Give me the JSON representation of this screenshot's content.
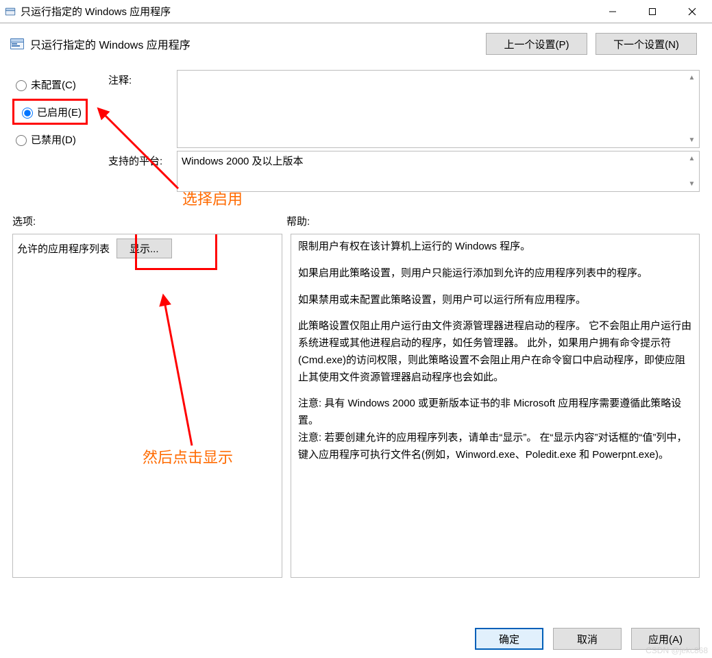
{
  "window": {
    "title": "只运行指定的 Windows 应用程序"
  },
  "header": {
    "policy_title": "只运行指定的 Windows 应用程序",
    "prev_btn": "上一个设置(P)",
    "next_btn": "下一个设置(N)"
  },
  "radios": {
    "not_configured": "未配置(C)",
    "enabled": "已启用(E)",
    "disabled": "已禁用(D)",
    "selected": "enabled"
  },
  "comment": {
    "label": "注释:",
    "value": ""
  },
  "platform": {
    "label": "支持的平台:",
    "value": "Windows 2000 及以上版本"
  },
  "sections": {
    "options_label": "选项:",
    "help_label": "帮助:"
  },
  "options": {
    "allowed_list_label": "允许的应用程序列表",
    "show_btn": "显示..."
  },
  "help": {
    "p1": "限制用户有权在该计算机上运行的 Windows 程序。",
    "p2": "如果启用此策略设置，则用户只能运行添加到允许的应用程序列表中的程序。",
    "p3": "如果禁用或未配置此策略设置，则用户可以运行所有应用程序。",
    "p4": "此策略设置仅阻止用户运行由文件资源管理器进程启动的程序。 它不会阻止用户运行由系统进程或其他进程启动的程序，如任务管理器。 此外，如果用户拥有命令提示符(Cmd.exe)的访问权限，则此策略设置不会阻止用户在命令窗口中启动程序，即使应阻止其使用文件资源管理器启动程序也会如此。",
    "p5": "注意: 具有 Windows 2000 或更新版本证书的非 Microsoft 应用程序需要遵循此策略设置。",
    "p6": "注意: 若要创建允许的应用程序列表，请单击“显示”。 在“显示内容”对话框的“值”列中，键入应用程序可执行文件名(例如，Winword.exe、Poledit.exe 和 Powerpnt.exe)。"
  },
  "annotations": {
    "enable_note": "选择启用",
    "show_note": "然后点击显示"
  },
  "buttons": {
    "ok": "确定",
    "cancel": "取消",
    "apply": "应用(A)"
  },
  "watermark": "CSDN @jekc868"
}
